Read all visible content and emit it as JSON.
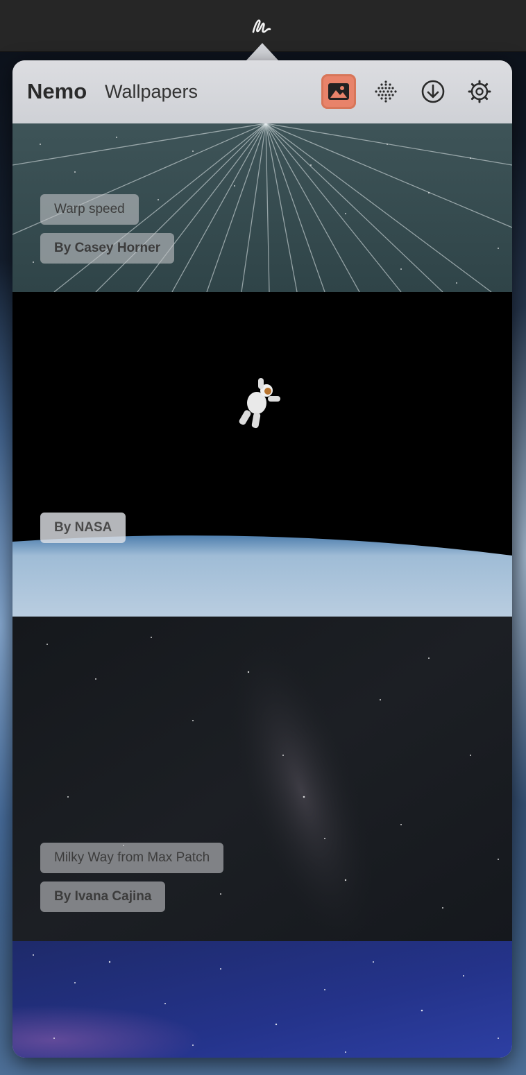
{
  "menubar": {
    "icon": "nemo-squiggle-icon"
  },
  "header": {
    "app_name": "Nemo",
    "section_title": "Wallpapers",
    "tools": [
      {
        "name": "wallpapers-icon",
        "active": true
      },
      {
        "name": "dots-grid-icon",
        "active": false
      },
      {
        "name": "download-icon",
        "active": false
      },
      {
        "name": "settings-gear-icon",
        "active": false
      }
    ],
    "accent_color": "#e8836a"
  },
  "wallpapers": [
    {
      "title": "Warp speed",
      "author": "By Casey Horner"
    },
    {
      "title": "",
      "author": "By NASA"
    },
    {
      "title": "Milky Way from Max Patch",
      "author": "By Ivana Cajina"
    },
    {
      "title": "",
      "author": ""
    }
  ]
}
